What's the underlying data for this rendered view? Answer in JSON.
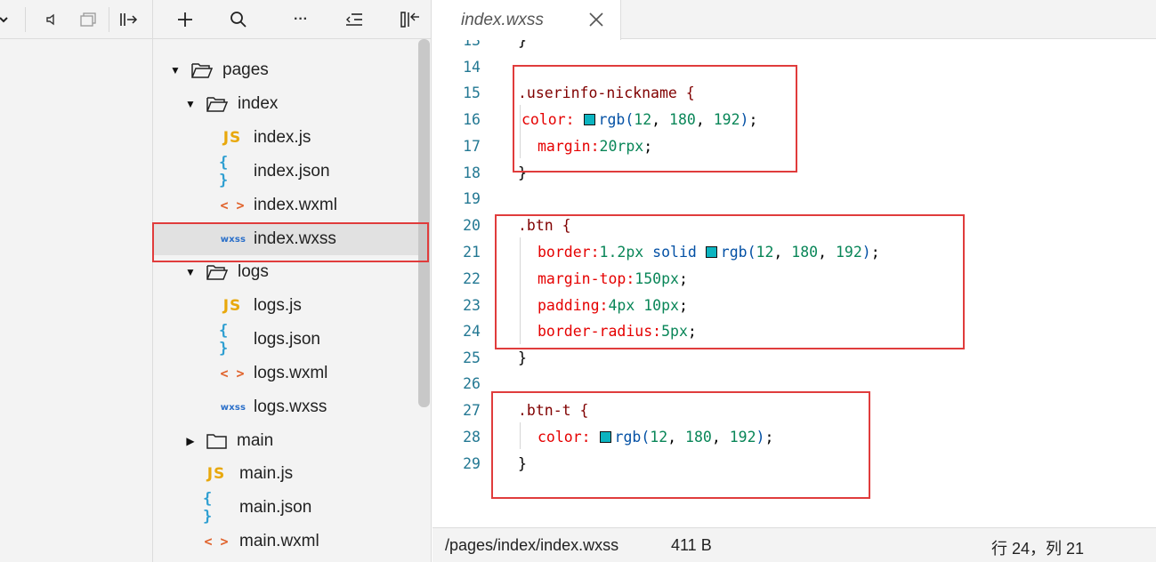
{
  "toolbar_left": {
    "icons": [
      "chevron-down-icon",
      "speaker-icon",
      "window-icon",
      "split-arrow-icon"
    ]
  },
  "explorer_toolbar": {
    "icons": [
      "plus-icon",
      "search-icon",
      "more-icon",
      "collapse-icon",
      "panel-toggle-icon"
    ],
    "more_label": "···"
  },
  "file_tree": [
    {
      "name": "pages",
      "type": "folder",
      "expanded": true
    },
    {
      "name": "index",
      "type": "folder",
      "expanded": true
    },
    {
      "name": "index.js",
      "type": "js",
      "icon_text": "JS"
    },
    {
      "name": "index.json",
      "type": "json",
      "icon_text": "{ }"
    },
    {
      "name": "index.wxml",
      "type": "wxml",
      "icon_text": "< >"
    },
    {
      "name": "index.wxss",
      "type": "wxss",
      "icon_text": "wxss",
      "selected": true
    },
    {
      "name": "logs",
      "type": "folder",
      "expanded": true
    },
    {
      "name": "logs.js",
      "type": "js",
      "icon_text": "JS"
    },
    {
      "name": "logs.json",
      "type": "json",
      "icon_text": "{ }"
    },
    {
      "name": "logs.wxml",
      "type": "wxml",
      "icon_text": "< >"
    },
    {
      "name": "logs.wxss",
      "type": "wxss",
      "icon_text": "wxss"
    },
    {
      "name": "main",
      "type": "folder",
      "expanded": false
    },
    {
      "name": "main.js",
      "type": "js",
      "icon_text": "JS"
    },
    {
      "name": "main.json",
      "type": "json",
      "icon_text": "{ }"
    },
    {
      "name": "main.wxml",
      "type": "wxml",
      "icon_text": "< >"
    }
  ],
  "editor": {
    "tab_label": "index.wxss",
    "lines": [
      {
        "n": "13",
        "text": "}"
      },
      {
        "n": "14",
        "text": ""
      },
      {
        "n": "15",
        "text": ".userinfo-nickname {"
      },
      {
        "n": "16",
        "text": "color: rgb(12, 180, 192);"
      },
      {
        "n": "17",
        "text": "margin:20rpx;"
      },
      {
        "n": "18",
        "text": "}"
      },
      {
        "n": "19",
        "text": ""
      },
      {
        "n": "20",
        "text": ".btn {"
      },
      {
        "n": "21",
        "text": "border:1.2px solid rgb(12, 180, 192);"
      },
      {
        "n": "22",
        "text": "margin-top:150px;"
      },
      {
        "n": "23",
        "text": "padding:4px 10px;"
      },
      {
        "n": "24",
        "text": "border-radius:5px;"
      },
      {
        "n": "25",
        "text": "}"
      },
      {
        "n": "26",
        "text": ""
      },
      {
        "n": "27",
        "text": ".btn-t {"
      },
      {
        "n": "28",
        "text": "color: rgb(12, 180, 192);"
      },
      {
        "n": "29",
        "text": "}"
      }
    ],
    "swatch_color": "#0cb4c0"
  },
  "status": {
    "path": "/pages/index/index.wxss",
    "size": "411 B",
    "position": "行 24，列 21"
  },
  "colors": {
    "annotation_red": "#e03c3c",
    "line_number": "#237893",
    "selector": "#800000",
    "property": "#e50000",
    "number": "#098658"
  }
}
